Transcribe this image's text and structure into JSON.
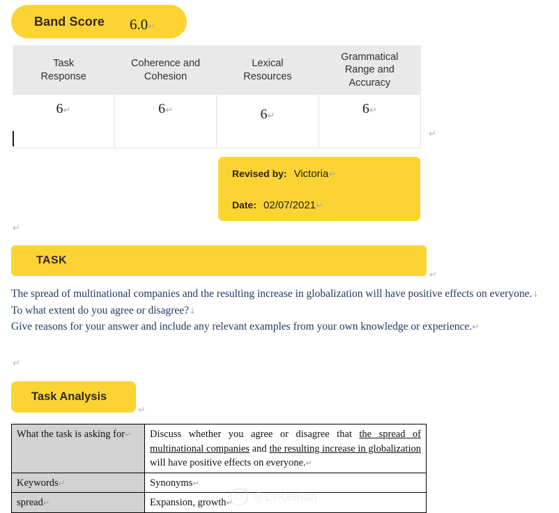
{
  "band": {
    "label": "Band Score",
    "value": "6.0",
    "paragraph_mark": "↵"
  },
  "score_table": {
    "columns": [
      "Task\nResponse",
      "Coherence and\nCohesion",
      "Lexical\nResources",
      "Grammatical\nRange and\nAccuracy"
    ],
    "scores": [
      "6",
      "6",
      "6",
      "6"
    ],
    "paragraph_mark": "↵",
    "trailing_mark": "↵"
  },
  "revised": {
    "by_label": "Revised by:",
    "by_value": "Victoria",
    "date_label": "Date:",
    "date_value": "02/07/2021",
    "paragraph_mark": "↵"
  },
  "marks": {
    "after_revised_card": "↵",
    "after_task_banner": "↵",
    "after_prompt": "↵"
  },
  "task": {
    "banner_label": "TASK",
    "lines": [
      {
        "text": "The spread of multinational companies and the resulting increase in globalization will have positive effects on everyone.",
        "mark": "↓"
      },
      {
        "text": "To what extent do you agree or disagree?",
        "mark": "↓"
      },
      {
        "text": "Give reasons for your answer and include any relevant examples from your own knowledge or experience.",
        "mark": "↵"
      }
    ]
  },
  "task_analysis": {
    "pill_label": "Task Analysis",
    "pill_mark": "↵",
    "rows": [
      {
        "key": "What the task is asking for",
        "key_mark": "↵",
        "value_prefix": "Discuss whether you agree or disagree that ",
        "value_underlined_1": "the spread of multinational companies",
        "value_middle": " and ",
        "value_underlined_2": "the resulting increase in globalization",
        "value_suffix": " will have positive effects on everyone.",
        "value_mark": "↵"
      },
      {
        "key": "Keywords",
        "key_mark": "↵",
        "value": "Synonyms",
        "value_mark": "↵"
      },
      {
        "key": "spread",
        "key_mark": "↵",
        "value": "Expansion, growth",
        "value_mark": "↵"
      }
    ]
  },
  "watermark": {
    "handle": "@LvKeelan",
    "logo": "weibo-logo"
  },
  "colors": {
    "highlight_yellow": "#FBD434",
    "header_gray": "#E9E9E9",
    "cell_gray": "#D2D2D2",
    "prompt_blue": "#1F3864"
  }
}
